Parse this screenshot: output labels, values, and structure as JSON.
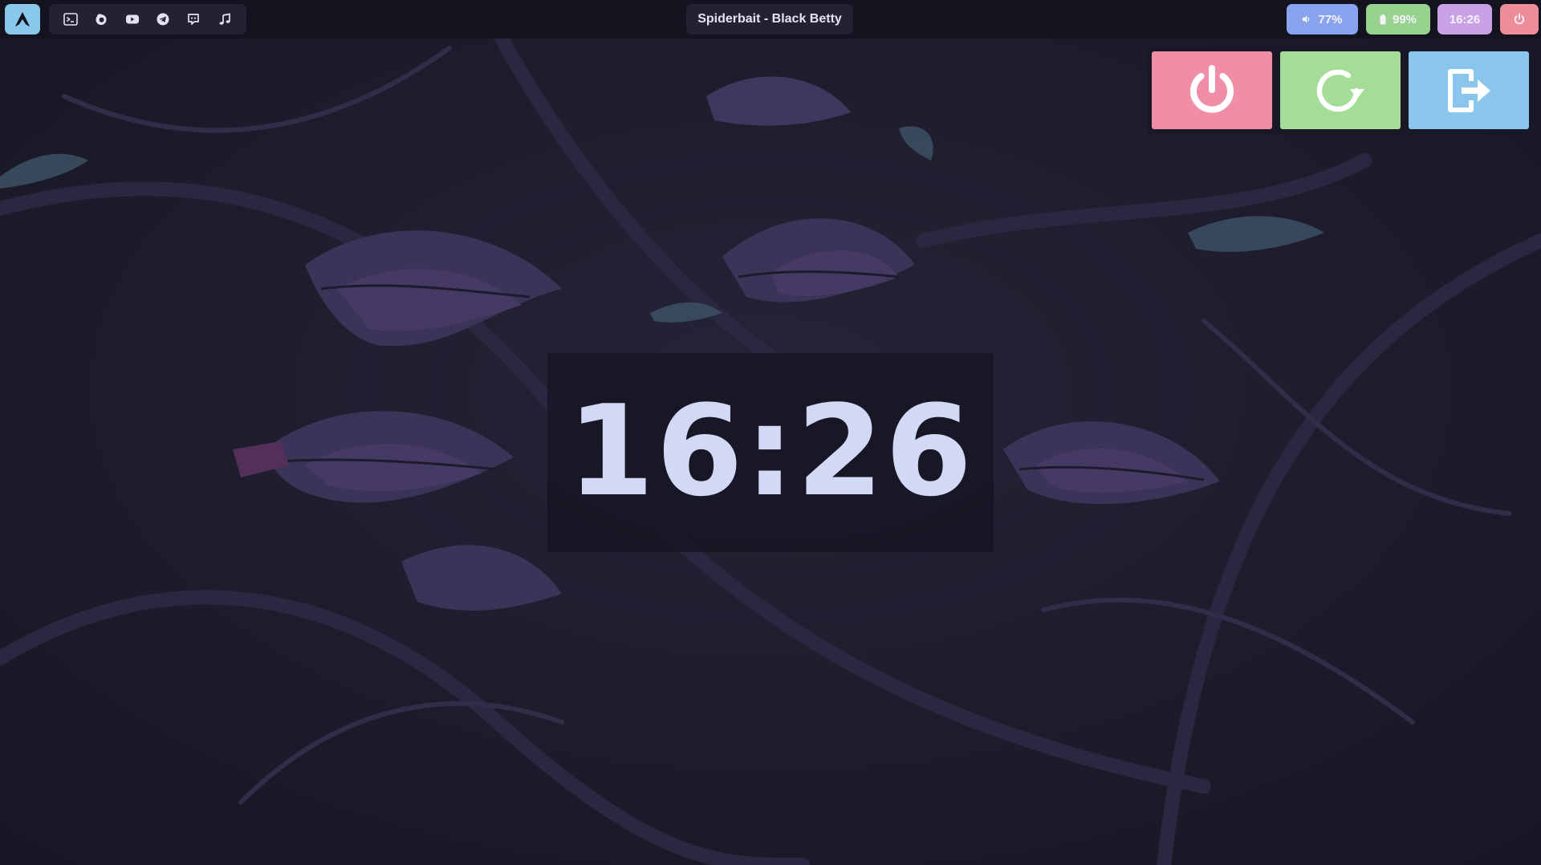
{
  "topbar": {
    "launcher": {
      "icon": "arch-logo-icon",
      "color": "#89c8ea"
    },
    "apps": [
      {
        "name": "terminal",
        "icon": "terminal-icon"
      },
      {
        "name": "firefox",
        "icon": "firefox-icon"
      },
      {
        "name": "youtube",
        "icon": "youtube-icon"
      },
      {
        "name": "telegram",
        "icon": "telegram-icon"
      },
      {
        "name": "discord",
        "icon": "discord-icon"
      },
      {
        "name": "music",
        "icon": "music-note-icon"
      }
    ],
    "window_title": "Spiderbait - Black Betty",
    "volume": {
      "icon": "volume-icon",
      "label": "77%",
      "level": 77,
      "color": "#89a3ee"
    },
    "battery": {
      "icon": "battery-icon",
      "label": "99%",
      "level": 99,
      "color": "#97d28e"
    },
    "clock": {
      "label": "16:26",
      "color": "#c9a2e6"
    },
    "power": {
      "icon": "power-icon",
      "color": "#ee8c99"
    }
  },
  "session_menu": {
    "buttons": [
      {
        "action": "shutdown",
        "icon": "power-icon",
        "color": "#f08ea8"
      },
      {
        "action": "reboot",
        "icon": "reboot-icon",
        "color": "#a5dd98"
      },
      {
        "action": "logout",
        "icon": "logout-icon",
        "color": "#8ac6eb"
      }
    ]
  },
  "desktop_clock": {
    "time": "16:26",
    "color": "#d3d8f7"
  }
}
